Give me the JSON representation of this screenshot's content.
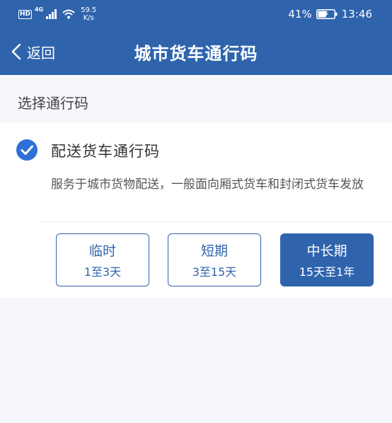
{
  "status_bar": {
    "hd": "HD",
    "network": "4G",
    "speed_value": "59.5",
    "speed_unit": "K/s",
    "battery": "41%",
    "time": "13:46"
  },
  "nav": {
    "back_label": "返回",
    "title": "城市货车通行码"
  },
  "section": {
    "title": "选择通行码"
  },
  "option": {
    "label": "配送货车通行码",
    "description": "服务于城市货物配送，一般面向厢式货车和封闭式货车发放",
    "checked": true
  },
  "durations": [
    {
      "name": "临时",
      "range": "1至3天",
      "selected": false
    },
    {
      "name": "短期",
      "range": "3至15天",
      "selected": false
    },
    {
      "name": "中长期",
      "range": "15天至1年",
      "selected": true
    }
  ],
  "colors": {
    "primary": "#2f64ad",
    "check": "#2f6fd6",
    "background": "#f5f7fb"
  }
}
